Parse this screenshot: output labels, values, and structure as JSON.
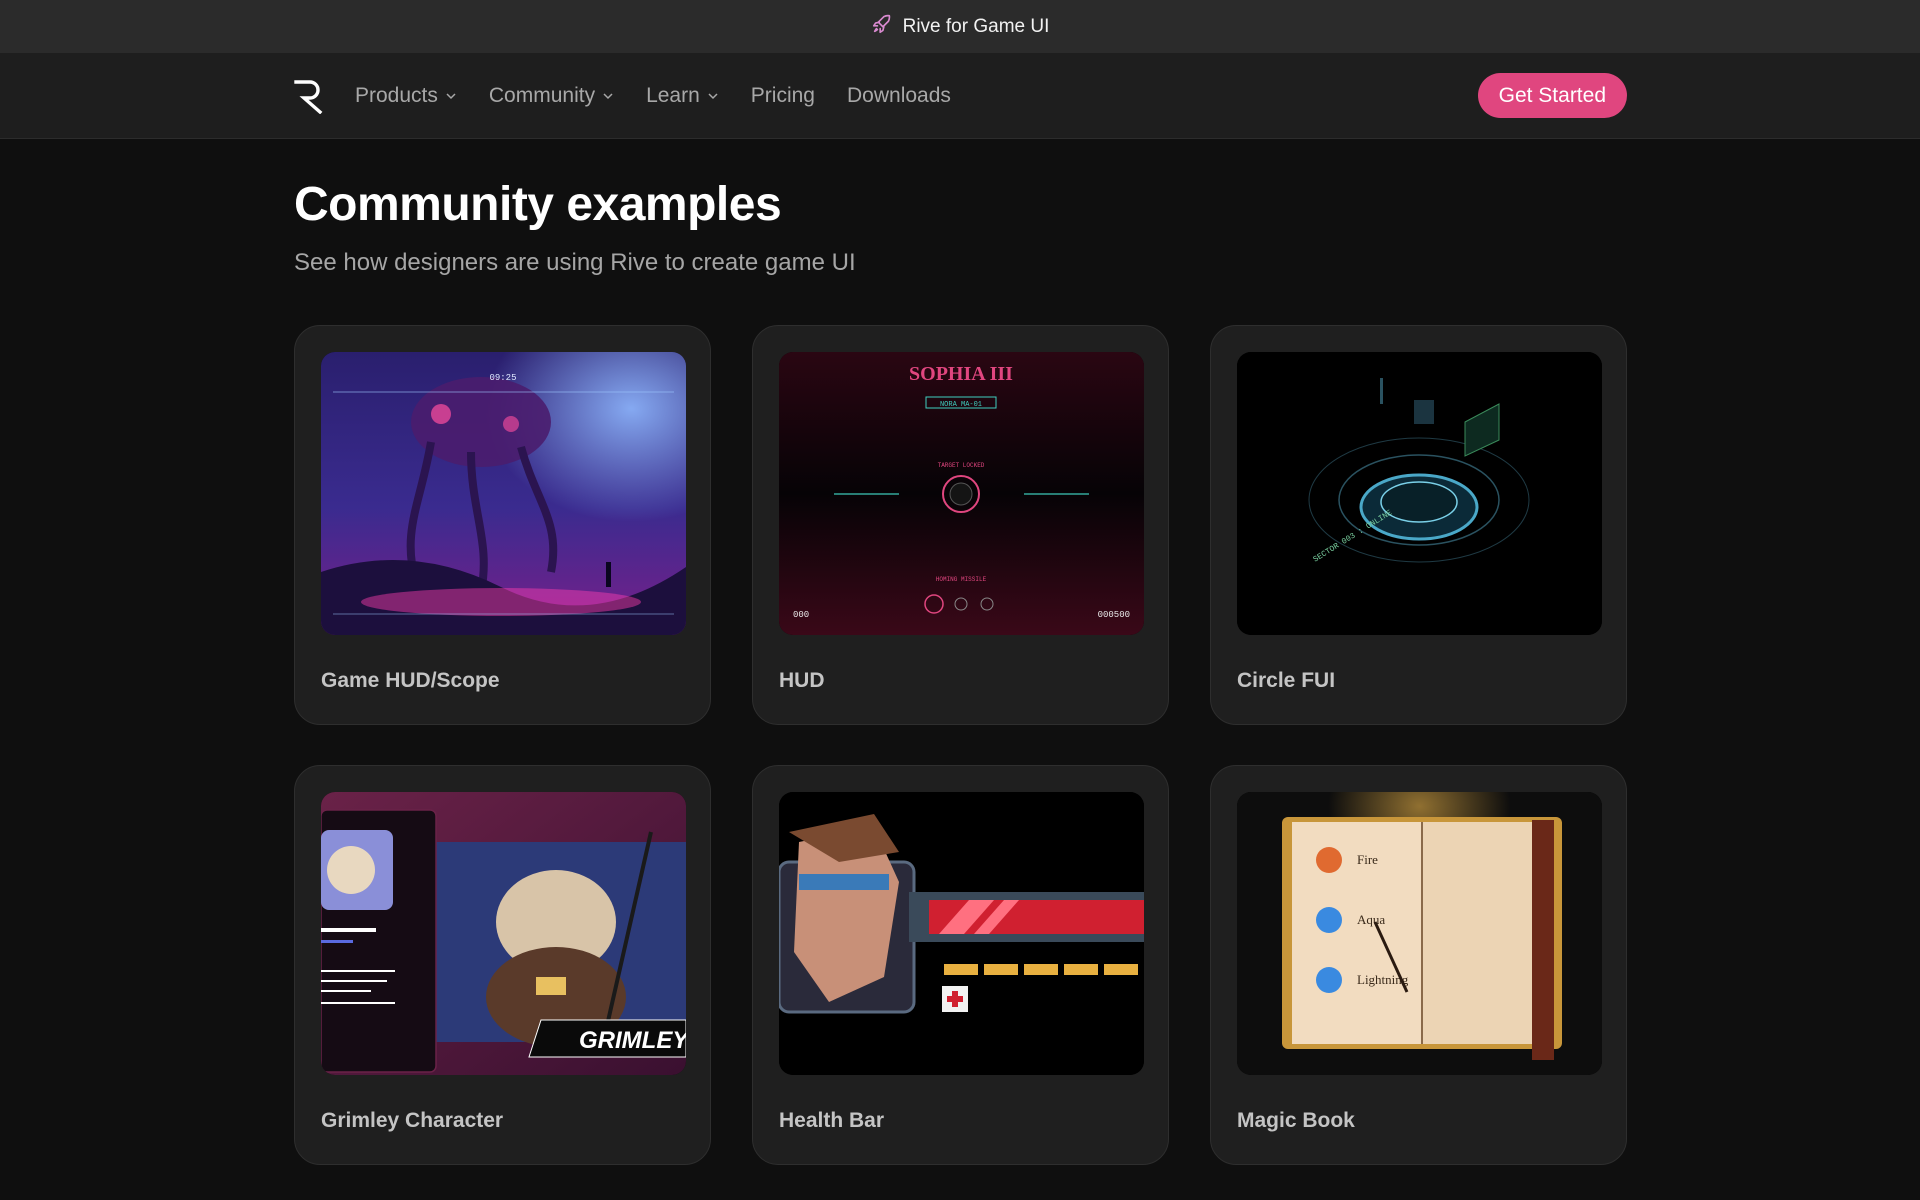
{
  "banner": {
    "icon": "rocket-icon",
    "text": "Rive for Game UI"
  },
  "nav": {
    "logo": "rive-logo",
    "items": [
      {
        "label": "Products",
        "dropdown": true
      },
      {
        "label": "Community",
        "dropdown": true
      },
      {
        "label": "Learn",
        "dropdown": true
      },
      {
        "label": "Pricing",
        "dropdown": false
      },
      {
        "label": "Downloads",
        "dropdown": false
      }
    ],
    "cta_label": "Get Started"
  },
  "page": {
    "title": "Community examples",
    "subtitle": "See how designers are using Rive to create game UI"
  },
  "cards": [
    {
      "label": "Game HUD/Scope",
      "thumb_text": [
        "09:25"
      ]
    },
    {
      "label": "HUD",
      "thumb_text": [
        "SOPHIA III",
        "NORA MA-01",
        "TARGET LOCKED",
        "HOMING MISSILE",
        "000",
        "000500"
      ]
    },
    {
      "label": "Circle FUI",
      "thumb_text": [
        "SECTOR 003 : ONLINE"
      ]
    },
    {
      "label": "Grimley Character",
      "thumb_text": [
        "GRIMLEY"
      ]
    },
    {
      "label": "Health Bar",
      "thumb_text": []
    },
    {
      "label": "Magic Book",
      "thumb_text": [
        "Fire",
        "Aqua",
        "Lightning"
      ]
    }
  ],
  "colors": {
    "accent": "#e0467f",
    "banner_bg": "#2b2b2b",
    "nav_bg": "#1e1e1e",
    "page_bg": "#0f0f0f",
    "card_bg": "#1f1f1f"
  }
}
